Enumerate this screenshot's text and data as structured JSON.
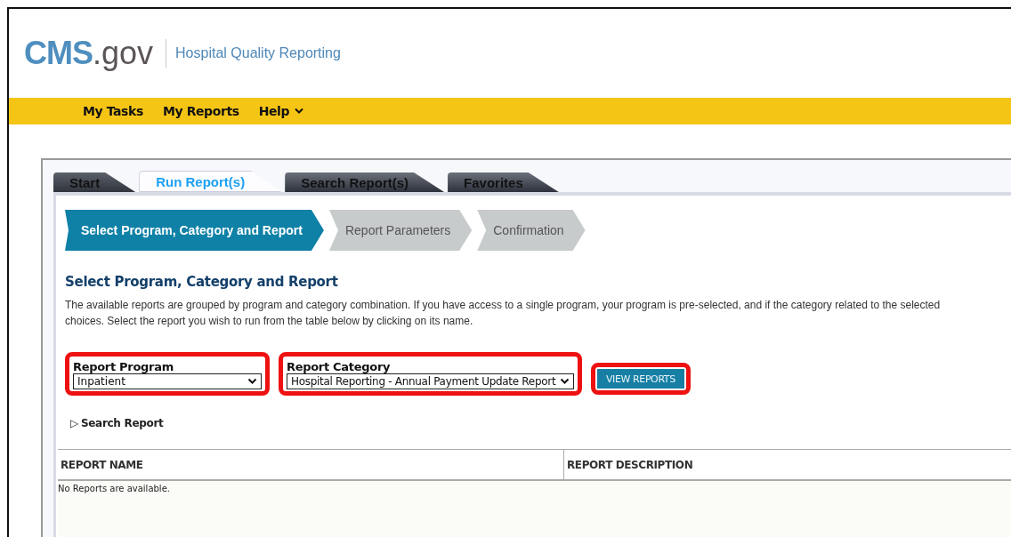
{
  "header": {
    "logo_main": "CMS",
    "logo_suffix": ".gov",
    "site_name": "Hospital Quality Reporting"
  },
  "nav": [
    {
      "label": "My Tasks",
      "has_menu": false
    },
    {
      "label": "My Reports",
      "has_menu": false
    },
    {
      "label": "Help",
      "has_menu": true
    }
  ],
  "tabs": [
    {
      "label": "Start",
      "selected": false
    },
    {
      "label": "Run Report(s)",
      "selected": true
    },
    {
      "label": "Search Report(s)",
      "selected": false
    },
    {
      "label": "Favorites",
      "selected": false
    }
  ],
  "steps": [
    {
      "label": "Select Program, Category and Report",
      "selected": true
    },
    {
      "label": "Report Parameters",
      "selected": false
    },
    {
      "label": "Confirmation",
      "selected": false
    }
  ],
  "section_title": "Select Program, Category and Report",
  "description": [
    "The available reports are grouped by program and category combination. If you have access to a single program, your program is pre-selected, and if the category related to the selected",
    "choices. Select the report you wish to run from the table below by clicking on its name."
  ],
  "fields": [
    {
      "label": "Report Program",
      "value": "Inpatient",
      "highlighted": true
    },
    {
      "label": "Report Category",
      "value": "Hospital Reporting - Annual Payment Update Report",
      "highlighted": true
    }
  ],
  "view_button": {
    "label": "VIEW REPORTS",
    "highlighted": true
  },
  "search_toggle": {
    "icon": "▷",
    "label": "Search Report",
    "expanded": false
  },
  "table": {
    "columns": [
      "REPORT NAME",
      "REPORT DESCRIPTION"
    ],
    "empty_message": "No Reports are available."
  }
}
